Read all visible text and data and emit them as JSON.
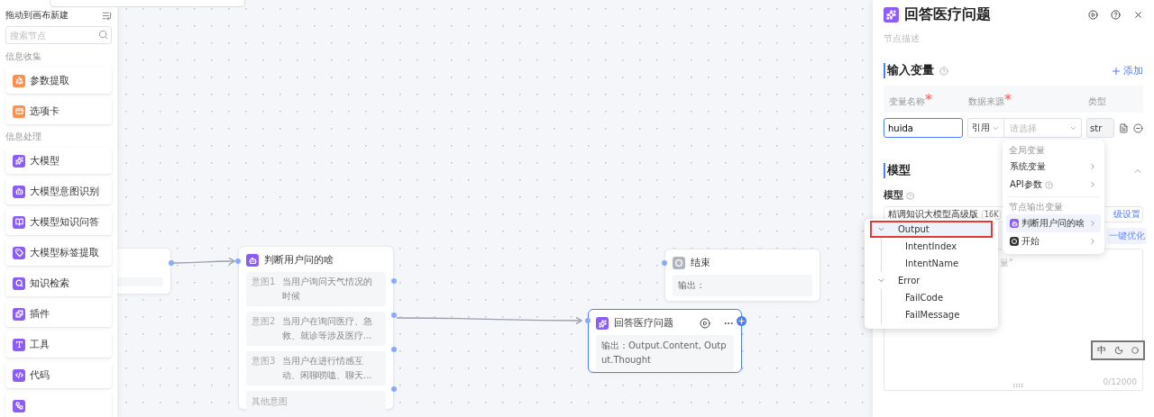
{
  "sidebar": {
    "title": "拖动到画布新建",
    "search": {
      "placeholder": "搜索节点"
    },
    "groups": [
      {
        "title": "信息收集",
        "items": [
          {
            "label": "参数提取",
            "kind": "extract",
            "color": "#ff8f4d"
          },
          {
            "label": "选项卡",
            "kind": "card",
            "color": "#ff8f4d"
          }
        ]
      },
      {
        "title": "信息处理",
        "items": [
          {
            "label": "大模型",
            "kind": "llm",
            "color": "#8b5cf6"
          },
          {
            "label": "大模型意图识别",
            "kind": "bot",
            "color": "#8b5cf6"
          },
          {
            "label": "大模型知识问答",
            "kind": "qa",
            "color": "#8b5cf6"
          },
          {
            "label": "大模型标签提取",
            "kind": "tag",
            "color": "#8b5cf6"
          },
          {
            "label": "知识检索",
            "kind": "search",
            "color": "#8b5cf6"
          },
          {
            "label": "插件",
            "kind": "plugin",
            "color": "#8b5cf6"
          },
          {
            "label": "工具",
            "kind": "tool",
            "color": "#8b5cf6"
          },
          {
            "label": "代码",
            "kind": "code",
            "color": "#8b5cf6"
          },
          {
            "kind": "flow",
            "color": "#8b5cf6"
          }
        ]
      }
    ]
  },
  "canvas": {
    "intent_node": {
      "title": "判断用户问的啥",
      "intents": [
        {
          "label": "意图1",
          "text": "当用户询问天气情况的时候"
        },
        {
          "label": "意图2",
          "text": "当用户在询问医疗、急救、就诊等涉及医疗..."
        },
        {
          "label": "意图3",
          "text": "当用户在进行情感互动、闲聊唠嗑、聊天..."
        }
      ],
      "other": "其他意图"
    },
    "end_node": {
      "title": "结束",
      "output": "输出："
    },
    "answer_node": {
      "title": "回答医疗问题",
      "output": "输出：Output.Content, Output.Thought",
      "selected": true
    }
  },
  "panel": {
    "title": "回答医疗问题",
    "description": {
      "placeholder": "节点描述"
    },
    "inputs": {
      "title": "输入变量",
      "add": "添加",
      "columns": [
        {
          "label": "变量名称",
          "mark": "*"
        },
        {
          "label": "数据来源",
          "mark": "*"
        },
        {
          "label": "类型"
        }
      ],
      "row": {
        "name": "huida",
        "source": "引用",
        "reference": {
          "placeholder": "请选择"
        },
        "type": "str"
      }
    },
    "model": {
      "title": "模型",
      "expanded": true,
      "label": "模型",
      "value": "精调知识大模型高级版",
      "badge": "16K",
      "link": "级设置",
      "optimize": "一键优化",
      "prompt_fragment": "量\"",
      "counter": "0/12000"
    },
    "dropdown": {
      "groups": [
        {
          "title": "全局变量",
          "items": [
            {
              "label": "系统变量",
              "kind": "plain",
              "help": false,
              "selected": false
            },
            {
              "label": "API参数",
              "kind": "plain",
              "help": true,
              "selected": false
            }
          ]
        },
        {
          "title": "节点输出变量",
          "items": [
            {
              "label": "判断用户问的啥",
              "kind": "bot",
              "help": false,
              "selected": true
            },
            {
              "label": "开始",
              "kind": "start",
              "help": false,
              "selected": false
            }
          ]
        }
      ]
    },
    "tree": [
      {
        "label": "Output",
        "expanded": true,
        "selected": true,
        "annotated": true,
        "children": [
          {
            "label": "IntentIndex"
          },
          {
            "label": "IntentName"
          }
        ]
      },
      {
        "label": "Error",
        "expanded": true,
        "selected": false,
        "annotated": false,
        "children": [
          {
            "label": "FailCode"
          },
          {
            "label": "FailMessage"
          }
        ]
      }
    ]
  },
  "ime": {
    "mode": "中"
  }
}
